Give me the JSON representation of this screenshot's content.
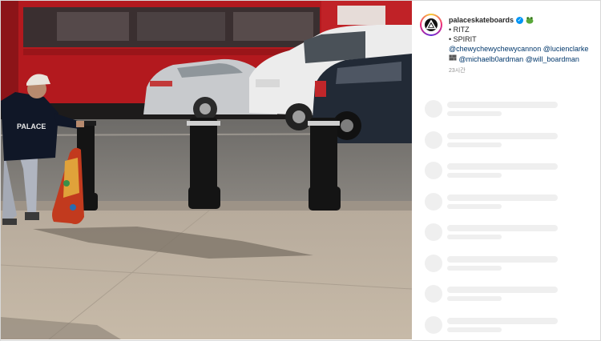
{
  "post": {
    "author": {
      "username": "palaceskateboards",
      "verified": true,
      "avatar_icon": "palace-triangle-logo",
      "emoji_icon": "frog-emoji"
    },
    "caption": {
      "line1": "• RITZ",
      "line2": "• SPIRIT",
      "mentions_row1": [
        "@chewychewychewycannon",
        "@lucienclarke"
      ],
      "mentions_row2_emoji": "brick-emoji",
      "mentions_row2": [
        "@michaelb0ardman",
        "@will_boardman"
      ]
    },
    "timestamp": "23시간"
  },
  "media": {
    "type": "video",
    "shirt_text": "PALACE"
  },
  "comments": {
    "loading_placeholders": 8
  },
  "colors": {
    "link": "#00376b",
    "verified_badge": "#0095f6",
    "skeleton": "#efefef",
    "text": "#262626",
    "muted": "#8e8e8e"
  }
}
